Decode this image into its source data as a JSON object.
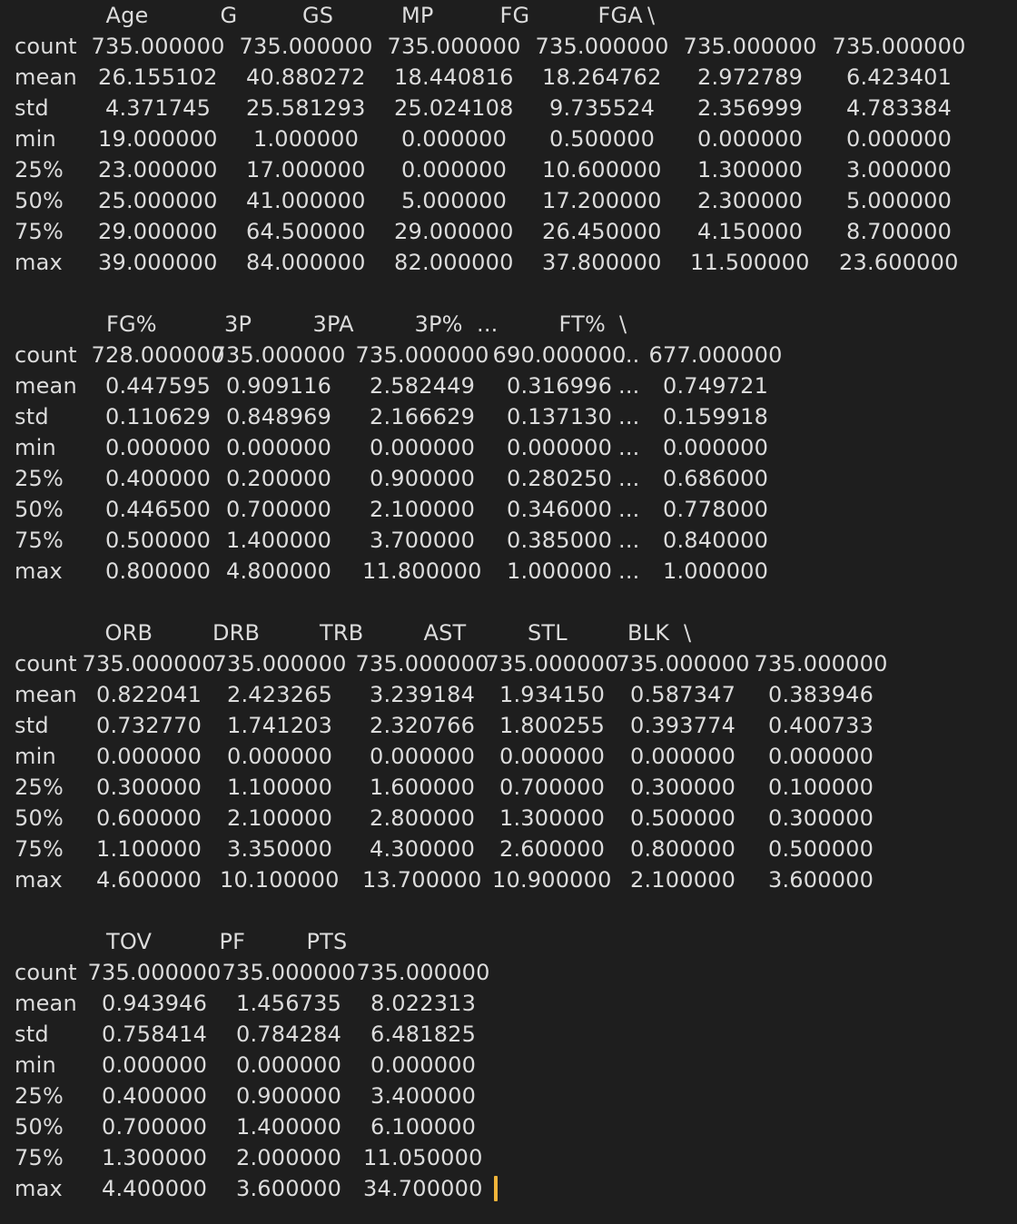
{
  "terminal": {
    "blocks": [
      {
        "headers": [
          "Age",
          "G",
          "GS",
          "MP",
          "FG",
          "FGA",
          "\\"
        ],
        "rows": [
          {
            "label": "count",
            "values": [
              "735.000000",
              "735.000000",
              "735.000000",
              "735.000000",
              "735.000000",
              "735.000000"
            ]
          },
          {
            "label": "mean",
            "values": [
              "26.155102",
              "40.880272",
              "18.440816",
              "18.264762",
              "2.972789",
              "6.423401"
            ]
          },
          {
            "label": "std",
            "values": [
              "4.371745",
              "25.581293",
              "25.024108",
              "9.735524",
              "2.356999",
              "4.783384"
            ]
          },
          {
            "label": "min",
            "values": [
              "19.000000",
              "1.000000",
              "0.000000",
              "0.500000",
              "0.000000",
              "0.000000"
            ]
          },
          {
            "label": "25%",
            "values": [
              "23.000000",
              "17.000000",
              "0.000000",
              "10.600000",
              "1.300000",
              "3.000000"
            ]
          },
          {
            "label": "50%",
            "values": [
              "25.000000",
              "41.000000",
              "5.000000",
              "17.200000",
              "2.300000",
              "5.000000"
            ]
          },
          {
            "label": "75%",
            "values": [
              "29.000000",
              "64.500000",
              "29.000000",
              "26.450000",
              "4.150000",
              "8.700000"
            ]
          },
          {
            "label": "max",
            "values": [
              "39.000000",
              "84.000000",
              "82.000000",
              "37.800000",
              "11.500000",
              "23.600000"
            ]
          }
        ]
      },
      {
        "headers": [
          "FG%",
          "3P",
          "3PA",
          "3P%",
          "...",
          "FT%",
          "\\"
        ],
        "rows": [
          {
            "label": "count",
            "values": [
              "728.000000",
              "735.000000",
              "735.000000",
              "690.000000",
              "...",
              "677.000000"
            ]
          },
          {
            "label": "mean",
            "values": [
              "0.447595",
              "0.909116",
              "2.582449",
              "0.316996",
              "...",
              "0.749721"
            ]
          },
          {
            "label": "std",
            "values": [
              "0.110629",
              "0.848969",
              "2.166629",
              "0.137130",
              "...",
              "0.159918"
            ]
          },
          {
            "label": "min",
            "values": [
              "0.000000",
              "0.000000",
              "0.000000",
              "0.000000",
              "...",
              "0.000000"
            ]
          },
          {
            "label": "25%",
            "values": [
              "0.400000",
              "0.200000",
              "0.900000",
              "0.280250",
              "...",
              "0.686000"
            ]
          },
          {
            "label": "50%",
            "values": [
              "0.446500",
              "0.700000",
              "2.100000",
              "0.346000",
              "...",
              "0.778000"
            ]
          },
          {
            "label": "75%",
            "values": [
              "0.500000",
              "1.400000",
              "3.700000",
              "0.385000",
              "...",
              "0.840000"
            ]
          },
          {
            "label": "max",
            "values": [
              "0.800000",
              "4.800000",
              "11.800000",
              "1.000000",
              "...",
              "1.000000"
            ]
          }
        ]
      },
      {
        "headers": [
          "ORB",
          "DRB",
          "TRB",
          "AST",
          "STL",
          "BLK",
          "\\"
        ],
        "rows": [
          {
            "label": "count",
            "values": [
              "735.000000",
              "735.000000",
              "735.000000",
              "735.000000",
              "735.000000",
              "735.000000"
            ]
          },
          {
            "label": "mean",
            "values": [
              "0.822041",
              "2.423265",
              "3.239184",
              "1.934150",
              "0.587347",
              "0.383946"
            ]
          },
          {
            "label": "std",
            "values": [
              "0.732770",
              "1.741203",
              "2.320766",
              "1.800255",
              "0.393774",
              "0.400733"
            ]
          },
          {
            "label": "min",
            "values": [
              "0.000000",
              "0.000000",
              "0.000000",
              "0.000000",
              "0.000000",
              "0.000000"
            ]
          },
          {
            "label": "25%",
            "values": [
              "0.300000",
              "1.100000",
              "1.600000",
              "0.700000",
              "0.300000",
              "0.100000"
            ]
          },
          {
            "label": "50%",
            "values": [
              "0.600000",
              "2.100000",
              "2.800000",
              "1.300000",
              "0.500000",
              "0.300000"
            ]
          },
          {
            "label": "75%",
            "values": [
              "1.100000",
              "3.350000",
              "4.300000",
              "2.600000",
              "0.800000",
              "0.500000"
            ]
          },
          {
            "label": "max",
            "values": [
              "4.600000",
              "10.100000",
              "13.700000",
              "10.900000",
              "2.100000",
              "3.600000"
            ]
          }
        ]
      },
      {
        "headers": [
          "TOV",
          "PF",
          "PTS"
        ],
        "rows": [
          {
            "label": "count",
            "values": [
              "735.000000",
              "735.000000",
              "735.000000"
            ]
          },
          {
            "label": "mean",
            "values": [
              "0.943946",
              "1.456735",
              "8.022313"
            ]
          },
          {
            "label": "std",
            "values": [
              "0.758414",
              "0.784284",
              "6.481825"
            ]
          },
          {
            "label": "min",
            "values": [
              "0.000000",
              "0.000000",
              "0.000000"
            ]
          },
          {
            "label": "25%",
            "values": [
              "0.400000",
              "0.900000",
              "3.400000"
            ]
          },
          {
            "label": "50%",
            "values": [
              "0.700000",
              "1.400000",
              "6.100000"
            ]
          },
          {
            "label": "75%",
            "values": [
              "1.300000",
              "2.000000",
              "11.050000"
            ]
          },
          {
            "label": "max",
            "values": [
              "4.400000",
              "3.600000",
              "34.700000"
            ]
          }
        ]
      }
    ],
    "cursor_color": "#f1b43a",
    "background_color": "#1e1e1e",
    "text_color": "#dcdcdc"
  }
}
